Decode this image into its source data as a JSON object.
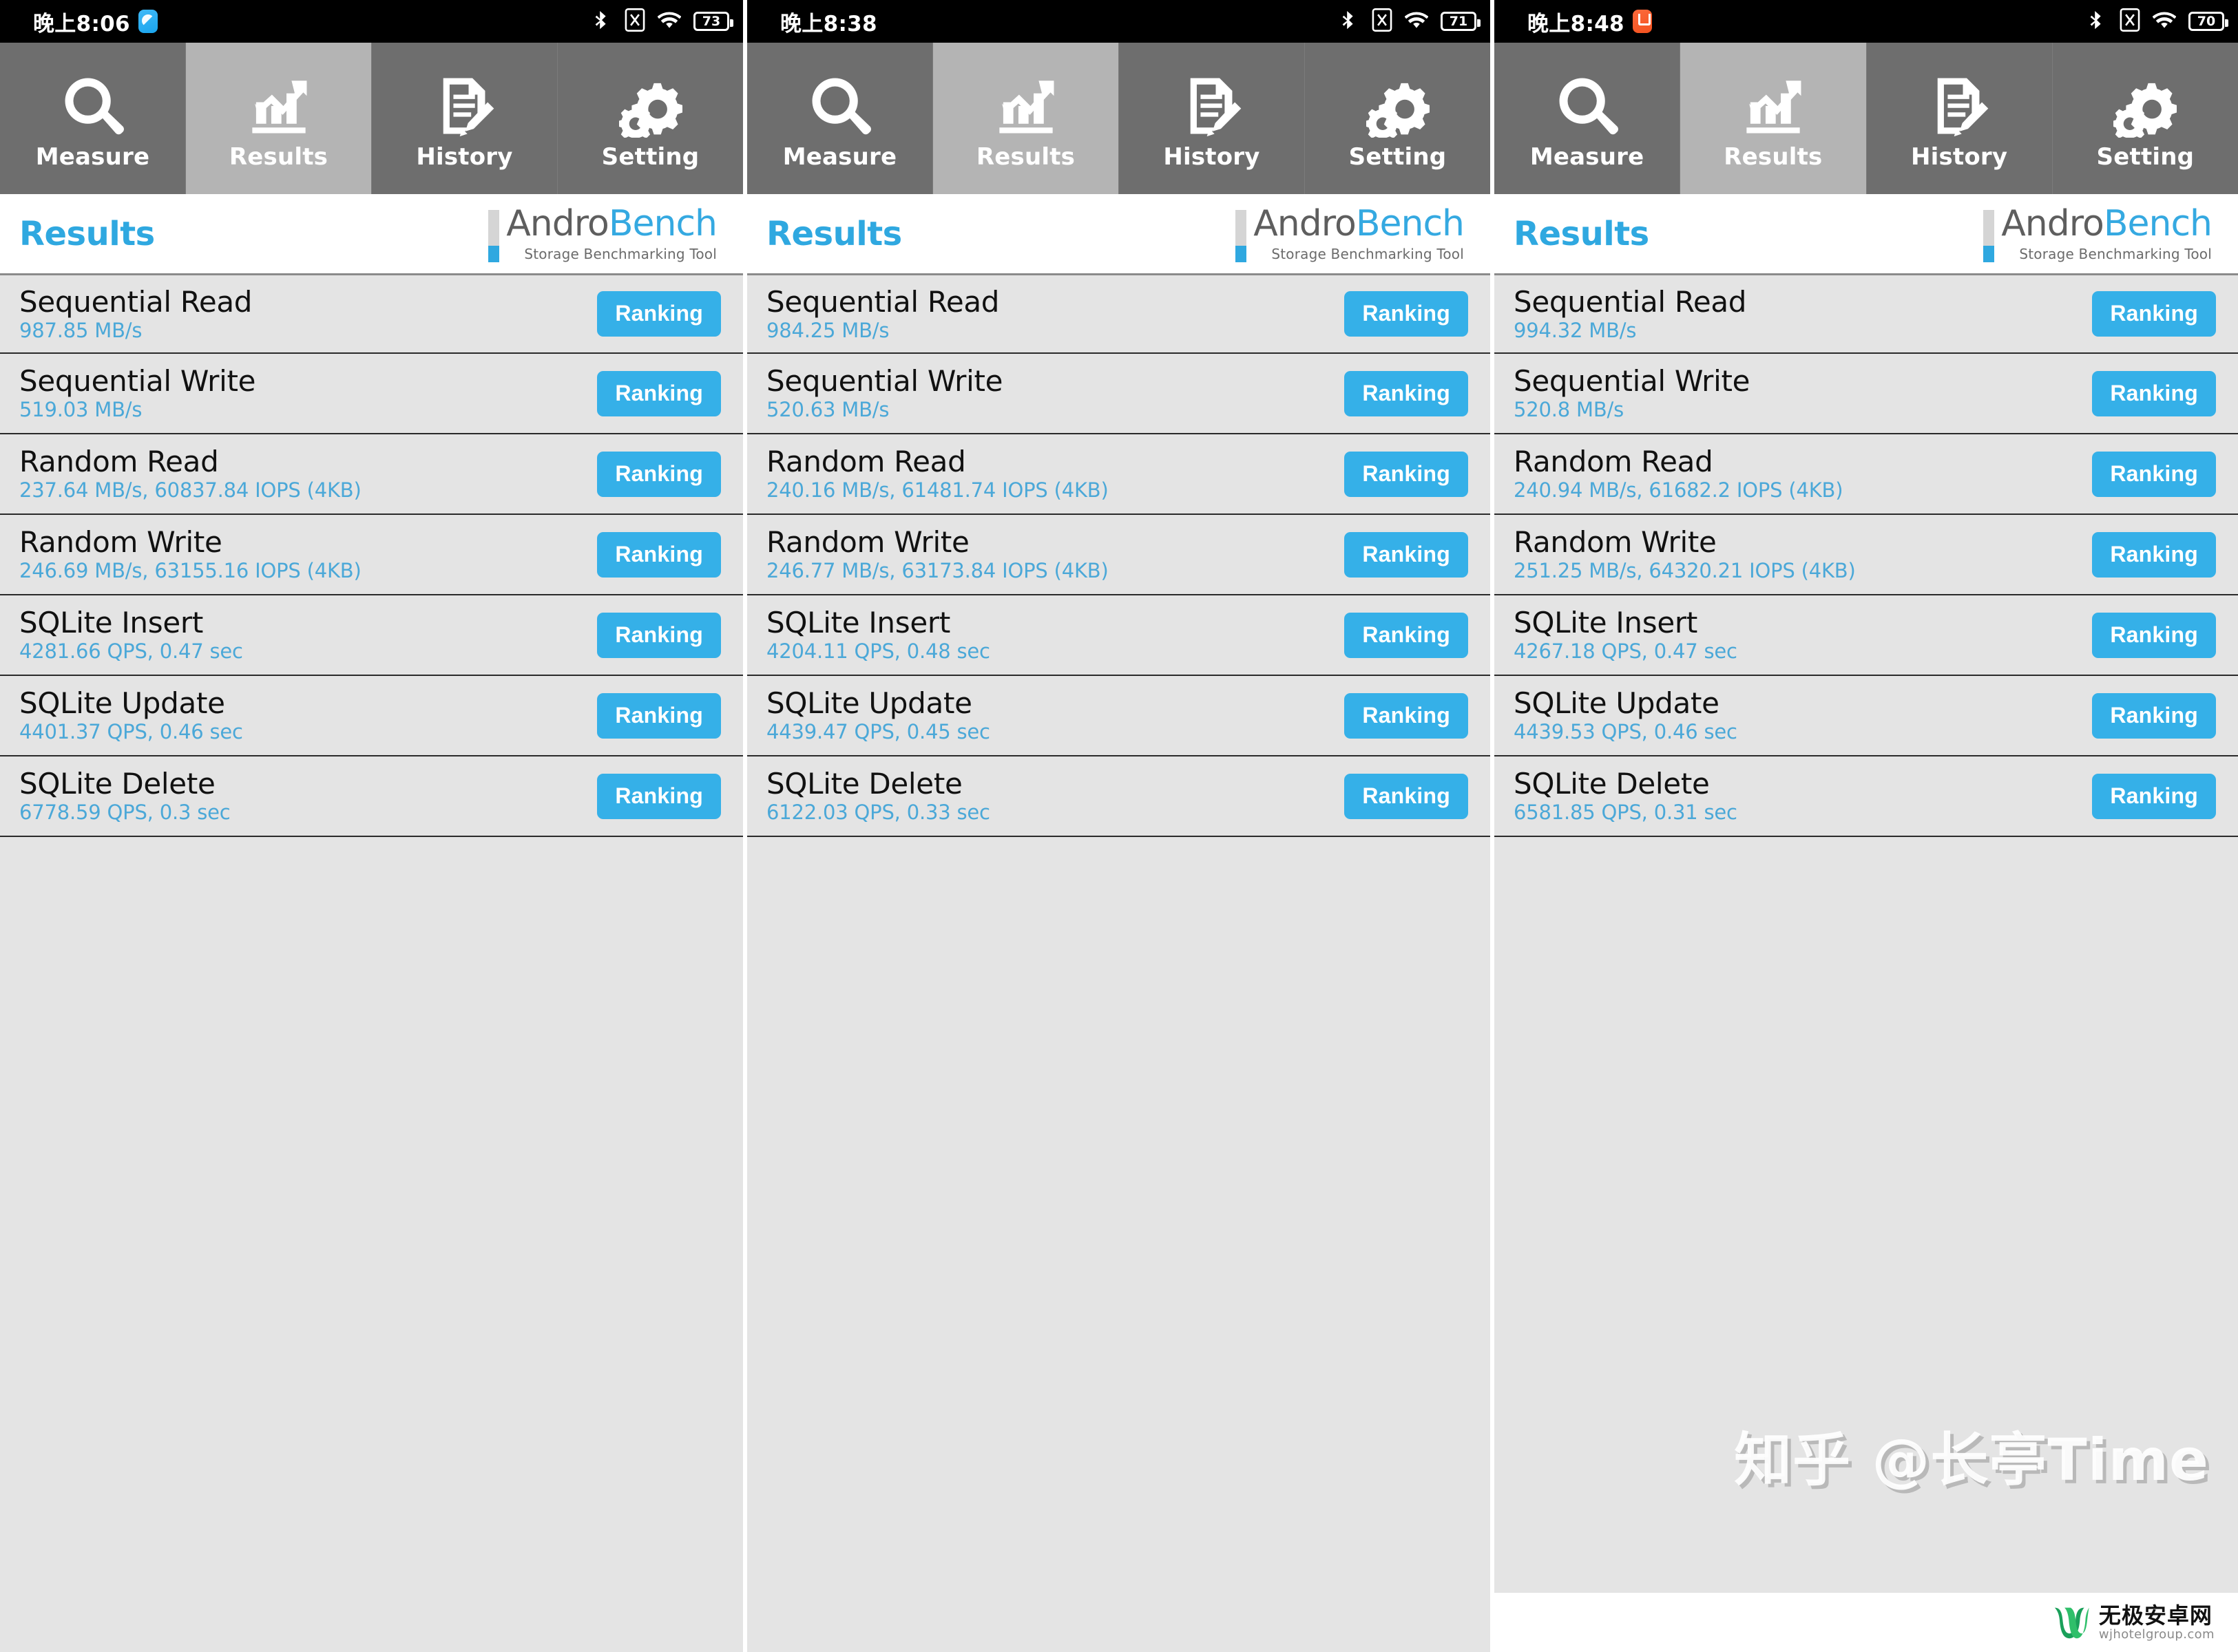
{
  "app": {
    "name": "AndroBench",
    "logo_primary": "Andro",
    "logo_accent": "Bench",
    "logo_subtitle": "Storage Benchmarking Tool",
    "accent_color": "#35b0e8",
    "value_color": "#4ba8d8",
    "tab_inactive_color": "#6e6e6e",
    "tab_active_color": "#b4b4b4"
  },
  "tabs": [
    {
      "label": "Measure",
      "icon": "search-icon",
      "active": false
    },
    {
      "label": "Results",
      "icon": "chart-icon",
      "active": true
    },
    {
      "label": "History",
      "icon": "document-pencil-icon",
      "active": false
    },
    {
      "label": "Setting",
      "icon": "gears-icon",
      "active": false
    }
  ],
  "ranking_label": "Ranking",
  "page_title": "Results",
  "panels": [
    {
      "status": {
        "time": "晚上8:06",
        "badge": "blue",
        "battery": "73",
        "icons": [
          "bluetooth-icon",
          "sim-x-icon",
          "wifi-icon",
          "battery-icon"
        ]
      },
      "rows": [
        {
          "label": "Sequential Read",
          "value": "987.85 MB/s"
        },
        {
          "label": "Sequential Write",
          "value": "519.03 MB/s"
        },
        {
          "label": "Random Read",
          "value": "237.64 MB/s, 60837.84 IOPS (4KB)"
        },
        {
          "label": "Random Write",
          "value": "246.69 MB/s, 63155.16 IOPS (4KB)"
        },
        {
          "label": "SQLite Insert",
          "value": "4281.66 QPS, 0.47 sec"
        },
        {
          "label": "SQLite Update",
          "value": "4401.37 QPS, 0.46 sec"
        },
        {
          "label": "SQLite Delete",
          "value": "6778.59 QPS, 0.3 sec"
        }
      ]
    },
    {
      "status": {
        "time": "晚上8:38",
        "badge": "none",
        "battery": "71",
        "icons": [
          "bluetooth-icon",
          "sim-x-icon",
          "wifi-icon",
          "battery-icon"
        ]
      },
      "rows": [
        {
          "label": "Sequential Read",
          "value": "984.25 MB/s"
        },
        {
          "label": "Sequential Write",
          "value": "520.63 MB/s"
        },
        {
          "label": "Random Read",
          "value": "240.16 MB/s, 61481.74 IOPS (4KB)"
        },
        {
          "label": "Random Write",
          "value": "246.77 MB/s, 63173.84 IOPS (4KB)"
        },
        {
          "label": "SQLite Insert",
          "value": "4204.11 QPS, 0.48 sec"
        },
        {
          "label": "SQLite Update",
          "value": "4439.47 QPS, 0.45 sec"
        },
        {
          "label": "SQLite Delete",
          "value": "6122.03 QPS, 0.33 sec"
        }
      ]
    },
    {
      "status": {
        "time": "晚上8:48",
        "badge": "orange",
        "battery": "70",
        "icons": [
          "bluetooth-icon",
          "sim-x-icon",
          "wifi-icon",
          "battery-icon"
        ]
      },
      "rows": [
        {
          "label": "Sequential Read",
          "value": "994.32 MB/s"
        },
        {
          "label": "Sequential Write",
          "value": "520.8 MB/s"
        },
        {
          "label": "Random Read",
          "value": "240.94 MB/s, 61682.2 IOPS (4KB)"
        },
        {
          "label": "Random Write",
          "value": "251.25 MB/s, 64320.21 IOPS (4KB)"
        },
        {
          "label": "SQLite Insert",
          "value": "4267.18 QPS, 0.47 sec"
        },
        {
          "label": "SQLite Update",
          "value": "4439.53 QPS, 0.46 sec"
        },
        {
          "label": "SQLite Delete",
          "value": "6581.85 QPS, 0.31 sec"
        }
      ]
    }
  ],
  "watermarks": {
    "zhihu": "知乎 @长亭Time",
    "site_title": "无极安卓网",
    "site_url": "wjhotelgroup.com"
  }
}
